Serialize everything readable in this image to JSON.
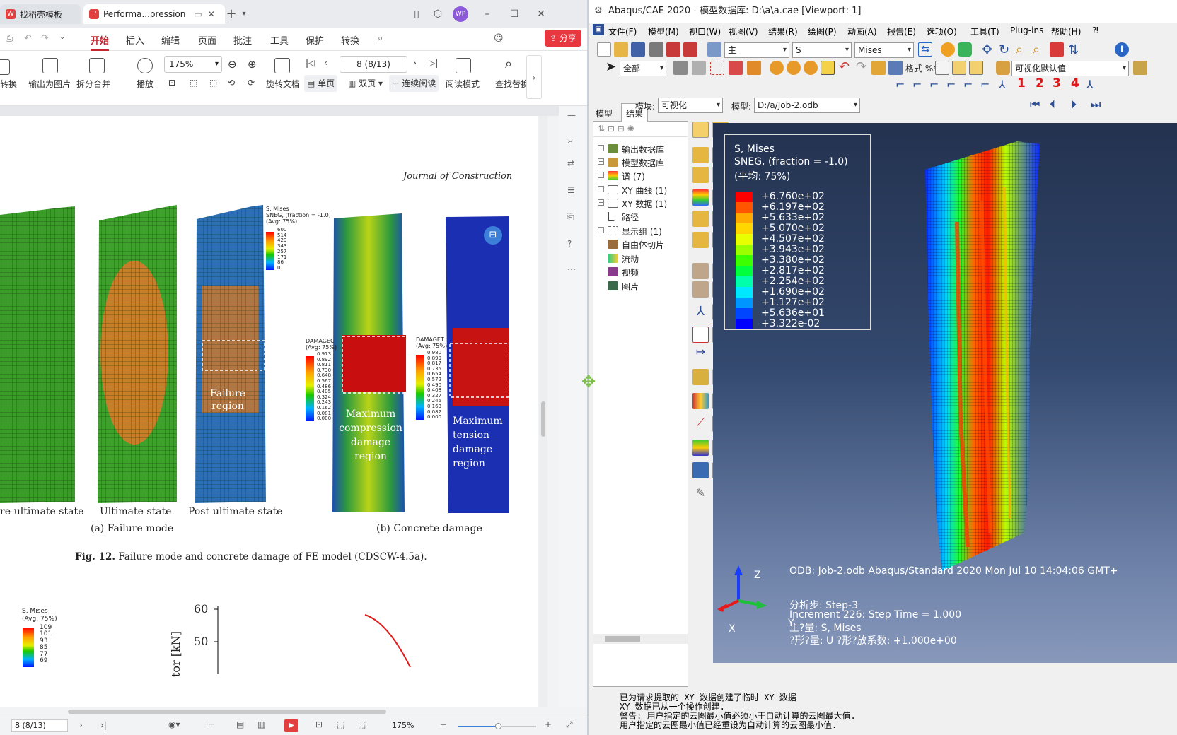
{
  "pdf": {
    "tabs": [
      "找稻壳模板",
      "Performa...pression"
    ],
    "menu": [
      "开始",
      "插入",
      "编辑",
      "页面",
      "批注",
      "工具",
      "保护",
      "转换"
    ],
    "share": "分享",
    "ribbon": {
      "convert": "转换",
      "export_img": "输出为图片",
      "split_merge": "拆分合并",
      "play": "播放",
      "zoom": "175%",
      "page_field": "8 (8/13)",
      "rotate": "旋转文档",
      "single": "单页",
      "double": "双页",
      "continuous": "连续阅读",
      "read_mode": "阅读模式",
      "find_replace": "查找替换"
    },
    "page": {
      "journal": "Journal of Construction",
      "label_pre": "re-ultimate state",
      "label_ult": "Ultimate state",
      "label_post": "Post-ultimate state",
      "cap_a": "(a) Failure mode",
      "cap_b": "(b) Concrete damage",
      "fig_caption_bold": "Fig. 12.",
      "fig_caption": "Failure mode and concrete damage of FE model (CDSCW-4.5a).",
      "failure_region": "Failure\nregion",
      "max_comp": "Maximum\ncompression\ndamage\nregion",
      "max_tens": "Maximum\ntension\ndamage\nregion",
      "mises_legend_title": "S, Mises\nSNEG, (fraction = -1.0)\n(Avg: 75%)",
      "mises_vals": [
        "600",
        "514",
        "429",
        "343",
        "257",
        "171",
        "86",
        "0"
      ],
      "damagec_title": "DAMAGEC\n(Avg: 75%)",
      "damagec_vals": [
        "0.973",
        "0.892",
        "0.811",
        "0.730",
        "0.648",
        "0.567",
        "0.486",
        "0.405",
        "0.324",
        "0.243",
        "0.162",
        "0.081",
        "0.000"
      ],
      "damaget_title": "DAMAGET\n(Avg: 75%)",
      "damaget_vals": [
        "0.980",
        "0.899",
        "0.817",
        "0.735",
        "0.654",
        "0.572",
        "0.490",
        "0.408",
        "0.327",
        "0.245",
        "0.163",
        "0.082",
        "0.000"
      ],
      "lower_legend_title": "S, Mises\n(Avg: 75%)",
      "lower_vals": [
        "109",
        "101",
        "93",
        "85",
        "77",
        "69"
      ],
      "ytick_60": "60",
      "ytick_50": "50",
      "ylabel_frag": "tor [kN]"
    },
    "status": {
      "page": "8 (8/13)",
      "zoom": "175%"
    }
  },
  "abaqus": {
    "title": "Abaqus/CAE 2020 - 模型数据库: D:\\a\\a.cae [Viewport: 1]",
    "menu": [
      "文件(F)",
      "模型(M)",
      "视口(W)",
      "视图(V)",
      "结果(R)",
      "绘图(P)",
      "动画(A)",
      "报告(E)",
      "选项(O)",
      "工具(T)",
      "Plug-ins",
      "帮助(H)",
      "⁈"
    ],
    "combos": {
      "primary": "主",
      "var": "S",
      "invariant": "Mises",
      "all": "全部",
      "vis_default": "可视化默认值",
      "module_label": "模块:",
      "module": "可视化",
      "model_label": "模型:",
      "model": "D:/a/Job-2.odb",
      "format_label": "格式 %s"
    },
    "view_nums": [
      "1",
      "2",
      "3",
      "4"
    ],
    "tree_tabs": [
      "模型",
      "结果"
    ],
    "tree": [
      "输出数据库",
      "模型数据库",
      "谱 (7)",
      "XY 曲线 (1)",
      "XY 数据 (1)",
      "路径",
      "显示组 (1)",
      "自由体切片",
      "流动",
      "视频",
      "图片"
    ],
    "legend": {
      "title1": "S, Mises",
      "title2": "SNEG, (fraction = -1.0)",
      "title3": "(平均: 75%)",
      "values": [
        "+6.760e+02",
        "+6.197e+02",
        "+5.633e+02",
        "+5.070e+02",
        "+4.507e+02",
        "+3.943e+02",
        "+3.380e+02",
        "+2.817e+02",
        "+2.254e+02",
        "+1.690e+02",
        "+1.127e+02",
        "+5.636e+01",
        "+3.322e-02"
      ],
      "colors": [
        "#ff0000",
        "#ff5500",
        "#ffaa00",
        "#ffd600",
        "#e7ff00",
        "#9cff00",
        "#3cff00",
        "#00ff3c",
        "#00ffaa",
        "#00e8ff",
        "#0096ff",
        "#0046ff",
        "#0000ff"
      ]
    },
    "info": {
      "odb": "ODB: Job-2.odb    Abaqus/Standard 2020    Mon Jul 10 14:04:06 GMT+",
      "step": "分析步: Step-3",
      "increment": "Increment    226: Step Time =    1.000",
      "primary_var": "主?量: S, Mises",
      "deform": "?形?量: U   ?形?放系数: +1.000e+00"
    },
    "axes": {
      "x": "X",
      "y": "Y",
      "z": "Z"
    },
    "messages": [
      "已为请求提取的 XY 数据创建了临时 XY 数据",
      "XY 数据已从一个操作创建.",
      "警告: 用户指定的云图最小值必须小于自动计算的云图最大值.",
      "用户指定的云图最小值已经重设为自动计算的云图最小值."
    ]
  }
}
